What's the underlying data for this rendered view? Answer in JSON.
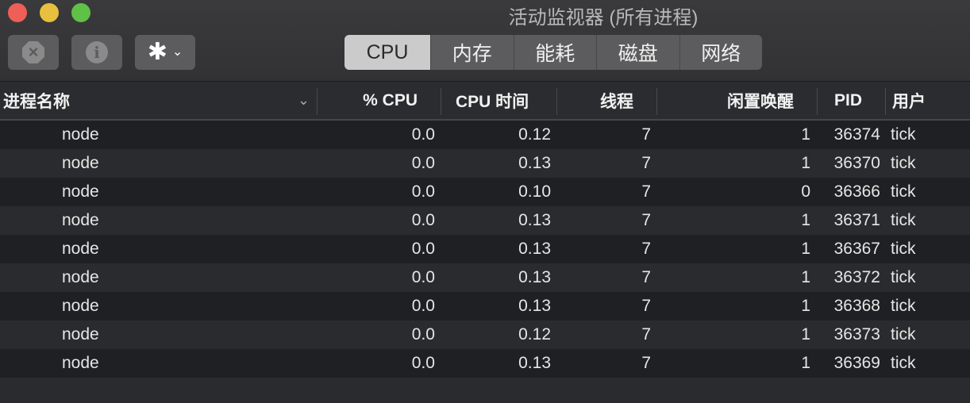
{
  "window": {
    "title": "活动监视器 (所有进程)"
  },
  "toolbar": {
    "stop_icon": "stop-process-icon",
    "stop_glyph": "×",
    "info_icon": "info-icon",
    "info_glyph": "i",
    "gear_icon": "gear-icon",
    "gear_glyph": "✱",
    "chevron_glyph": "⌄",
    "tabs": [
      {
        "label": "CPU",
        "active": true
      },
      {
        "label": "内存",
        "active": false
      },
      {
        "label": "能耗",
        "active": false
      },
      {
        "label": "磁盘",
        "active": false
      },
      {
        "label": "网络",
        "active": false
      }
    ]
  },
  "table": {
    "sort_glyph": "⌄",
    "columns": {
      "name": "进程名称",
      "cpu_pct": "% CPU",
      "cpu_time": "CPU 时间",
      "threads": "线程",
      "idle_wakeups": "闲置唤醒",
      "pid": "PID",
      "user": "用户"
    },
    "rows": [
      {
        "name": "node",
        "cpu_pct": "0.0",
        "cpu_time": "0.12",
        "threads": "7",
        "idle_wakeups": "1",
        "pid": "36374",
        "user": "tick"
      },
      {
        "name": "node",
        "cpu_pct": "0.0",
        "cpu_time": "0.13",
        "threads": "7",
        "idle_wakeups": "1",
        "pid": "36370",
        "user": "tick"
      },
      {
        "name": "node",
        "cpu_pct": "0.0",
        "cpu_time": "0.10",
        "threads": "7",
        "idle_wakeups": "0",
        "pid": "36366",
        "user": "tick"
      },
      {
        "name": "node",
        "cpu_pct": "0.0",
        "cpu_time": "0.13",
        "threads": "7",
        "idle_wakeups": "1",
        "pid": "36371",
        "user": "tick"
      },
      {
        "name": "node",
        "cpu_pct": "0.0",
        "cpu_time": "0.13",
        "threads": "7",
        "idle_wakeups": "1",
        "pid": "36367",
        "user": "tick"
      },
      {
        "name": "node",
        "cpu_pct": "0.0",
        "cpu_time": "0.13",
        "threads": "7",
        "idle_wakeups": "1",
        "pid": "36372",
        "user": "tick"
      },
      {
        "name": "node",
        "cpu_pct": "0.0",
        "cpu_time": "0.13",
        "threads": "7",
        "idle_wakeups": "1",
        "pid": "36368",
        "user": "tick"
      },
      {
        "name": "node",
        "cpu_pct": "0.0",
        "cpu_time": "0.12",
        "threads": "7",
        "idle_wakeups": "1",
        "pid": "36373",
        "user": "tick"
      },
      {
        "name": "node",
        "cpu_pct": "0.0",
        "cpu_time": "0.13",
        "threads": "7",
        "idle_wakeups": "1",
        "pid": "36369",
        "user": "tick"
      }
    ]
  }
}
